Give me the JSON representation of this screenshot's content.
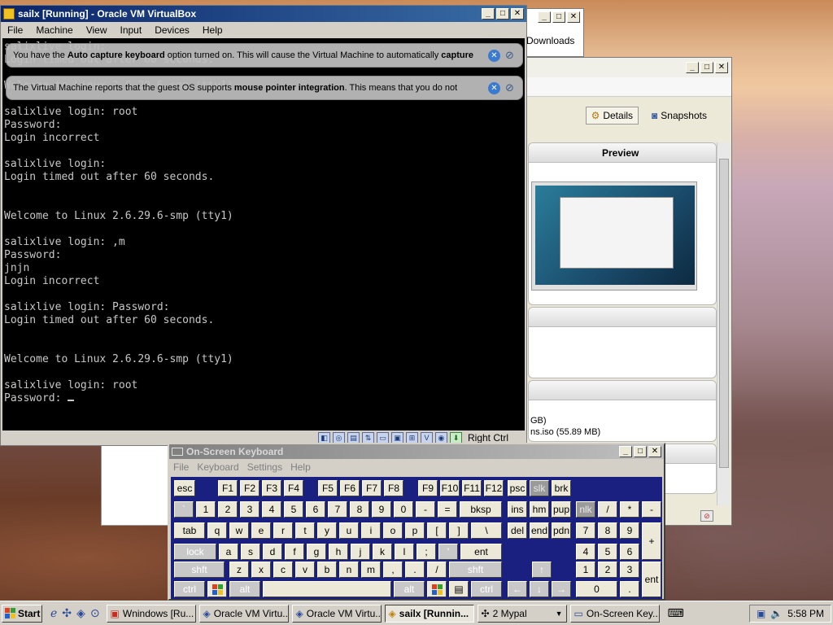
{
  "desktop": {
    "theme": "desert-sunset"
  },
  "downloads_window": {
    "label": "Downloads"
  },
  "vbox_manager": {
    "tabs": [
      {
        "label": "Details",
        "icon": "gear-icon"
      },
      {
        "label": "Snapshots",
        "icon": "camera-icon"
      }
    ],
    "preview_header": "Preview",
    "storage_line1": "GB)",
    "storage_line2": "ns.iso (55.89 MB)"
  },
  "vm_window": {
    "title": "sailx [Running] - Oracle VM VirtualBox",
    "menu": [
      "File",
      "Machine",
      "View",
      "Input",
      "Devices",
      "Help"
    ],
    "banner1": {
      "prefix": "You have the ",
      "bold1": "Auto capture keyboard",
      "middle": " option turned on. This will cause the Virtual Machine to automatically ",
      "bold2": "capture"
    },
    "banner2": {
      "prefix": "The Virtual Machine reports that the guest OS supports ",
      "bold1": "mouse pointer integration",
      "suffix": ". This means that you do not"
    },
    "console_lines": [
      "salixlive login:",
      "Login timed out after 60 seconds.",
      "",
      "Welcome to Linux 2.6.29.6-smp (tty1)",
      "",
      "salixlive login: root",
      "Password:",
      "Login incorrect",
      "",
      "salixlive login:",
      "Login timed out after 60 seconds.",
      "",
      "",
      "Welcome to Linux 2.6.29.6-smp (tty1)",
      "",
      "salixlive login: ,m",
      "Password:",
      "jnjn",
      "Login incorrect",
      "",
      "salixlive login: Password:",
      "Login timed out after 60 seconds.",
      "",
      "",
      "Welcome to Linux 2.6.29.6-smp (tty1)",
      "",
      "salixlive login: root",
      "Password: "
    ],
    "host_key": "Right Ctrl"
  },
  "osk": {
    "title": "On-Screen Keyboard",
    "menu": [
      "File",
      "Keyboard",
      "Settings",
      "Help"
    ],
    "keys": {
      "esc": "esc",
      "f1": "F1",
      "f2": "F2",
      "f3": "F3",
      "f4": "F4",
      "f5": "F5",
      "f6": "F6",
      "f7": "F7",
      "f8": "F8",
      "f9": "F9",
      "f10": "F10",
      "f11": "F11",
      "f12": "F12",
      "psc": "psc",
      "slk": "slk",
      "brk": "brk",
      "tilde": "`",
      "n1": "1",
      "n2": "2",
      "n3": "3",
      "n4": "4",
      "n5": "5",
      "n6": "6",
      "n7": "7",
      "n8": "8",
      "n9": "9",
      "n0": "0",
      "minus": "-",
      "equals": "=",
      "bksp": "bksp",
      "ins": "ins",
      "hm": "hm",
      "pup": "pup",
      "nlk": "nlk",
      "kp_div": "/",
      "kp_mul": "*",
      "kp_min": "-",
      "tab": "tab",
      "q": "q",
      "w": "w",
      "e": "e",
      "r": "r",
      "t": "t",
      "y": "y",
      "u": "u",
      "i": "i",
      "o": "o",
      "p": "p",
      "lbr": "[",
      "rbr": "]",
      "bslash": "\\",
      "del": "del",
      "end": "end",
      "pdn": "pdn",
      "kp7": "7",
      "kp8": "8",
      "kp9": "9",
      "kp_plus": "+",
      "lock": "lock",
      "a": "a",
      "s": "s",
      "d": "d",
      "f": "f",
      "g": "g",
      "h": "h",
      "j": "j",
      "k": "k",
      "l": "l",
      "semi": ";",
      "quote": "'",
      "ent": "ent",
      "kp4": "4",
      "kp5": "5",
      "kp6": "6",
      "lshft": "shft",
      "z": "z",
      "x": "x",
      "c": "c",
      "v": "v",
      "b": "b",
      "n": "n",
      "m": "m",
      "comma": ",",
      "period": ".",
      "slash": "/",
      "rshft": "shft",
      "up": "↑",
      "kp1": "1",
      "kp2": "2",
      "kp3": "3",
      "lctrl": "ctrl",
      "lalt": "alt",
      "ralt": "alt",
      "rctrl": "ctrl",
      "left": "←",
      "down": "↓",
      "right": "→",
      "kp0": "0",
      "kp_dot": ".",
      "kp_ent": "ent"
    }
  },
  "taskbar": {
    "start": "Start",
    "tasks": [
      "Wnindows [Ru...",
      "Oracle VM Virtu...",
      "Oracle VM Virtu...",
      "sailx [Runnin...",
      "2 Mypal",
      "On-Screen Key..."
    ],
    "clock": "5:58 PM"
  }
}
